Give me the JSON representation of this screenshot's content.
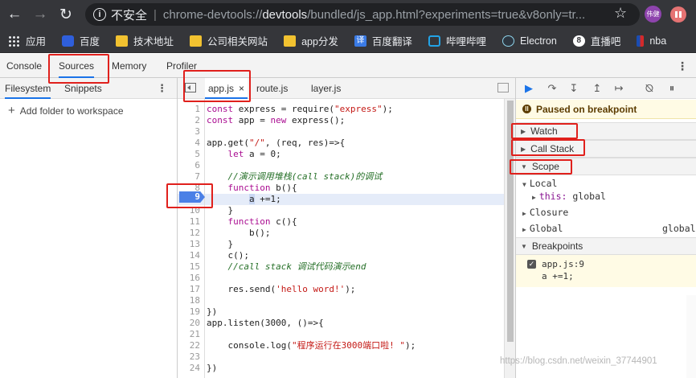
{
  "browser": {
    "nav": {
      "back_icon": "arrow-back-icon",
      "forward_icon": "arrow-forward-icon",
      "reload_icon": "reload-icon"
    },
    "omnibox": {
      "security_label": "不安全",
      "url_scheme": "chrome-devtools://",
      "url_host": "devtools",
      "url_path": "/bundled/js_app.html?experiments=true&v8only=tr..."
    },
    "profile_label": "伟健"
  },
  "bookmarks": [
    {
      "label": "应用",
      "icon": "apps-grid-icon"
    },
    {
      "label": "百度",
      "icon": "baidu-paw-icon"
    },
    {
      "label": "技术地址",
      "icon": "folder-icon"
    },
    {
      "label": "公司相关网站",
      "icon": "folder-icon"
    },
    {
      "label": "app分发",
      "icon": "folder-icon"
    },
    {
      "label": "百度翻译",
      "icon": "baidu-translate-icon",
      "icon_text": "译"
    },
    {
      "label": "哔哩哔哩",
      "icon": "bilibili-tv-icon"
    },
    {
      "label": "Electron",
      "icon": "electron-atom-icon"
    },
    {
      "label": "直播吧",
      "icon": "zhibo8-icon",
      "icon_text": "8"
    },
    {
      "label": "nba",
      "icon": "nba-logo-icon"
    }
  ],
  "devtools": {
    "tabs": [
      "Console",
      "Sources",
      "Memory",
      "Profiler"
    ],
    "active_tab": "Sources",
    "navigator": {
      "tabs": [
        "Filesystem",
        "Snippets"
      ],
      "active_tab": "Filesystem",
      "add_folder_label": "Add folder to workspace"
    },
    "editor": {
      "files": [
        {
          "name": "app.js",
          "active": true,
          "close": "×"
        },
        {
          "name": "route.js",
          "active": false
        },
        {
          "name": "layer.js",
          "active": false
        }
      ],
      "paused_line": 9,
      "lines": [
        "const express = require(\"express\");",
        "const app = new express();",
        "",
        "app.get(\"/\", (req, res)=>{",
        "    let a = 0;",
        "",
        "    //演示调用堆栈(call stack)的调试",
        "    function b(){",
        "        a +=1;",
        "    }",
        "    function c(){",
        "        b();",
        "    }",
        "    c();",
        "    //call stack 调试代码演示end",
        "",
        "    res.send('hello word!');",
        "",
        "})",
        "app.listen(3000, ()=>{",
        "",
        "    console.log(\"程序运行在3000端口啦! \");",
        "",
        "})"
      ]
    },
    "debugger": {
      "toolbar_icons": [
        "resume-icon",
        "step-over-icon",
        "step-into-icon",
        "step-out-icon",
        "step-icon",
        "deactivate-breakpoints-icon",
        "pause-on-exceptions-icon"
      ],
      "paused_message": "Paused on breakpoint",
      "panes": {
        "watch": "Watch",
        "call_stack": "Call Stack",
        "scope": "Scope",
        "breakpoints": "Breakpoints"
      },
      "scope": {
        "local": "Local",
        "this_key": "this:",
        "this_value": "global",
        "closure": "Closure",
        "global": "Global",
        "global_value": "global"
      },
      "breakpoint": {
        "location": "app.js:9",
        "code": "a +=1;",
        "checked": true
      }
    }
  },
  "watermark": "https://blog.csdn.net/weixin_37744901",
  "colors": {
    "annotation_red": "#e0201c",
    "accent_blue": "#1a73e8",
    "paused_banner": "#fffbe5"
  }
}
